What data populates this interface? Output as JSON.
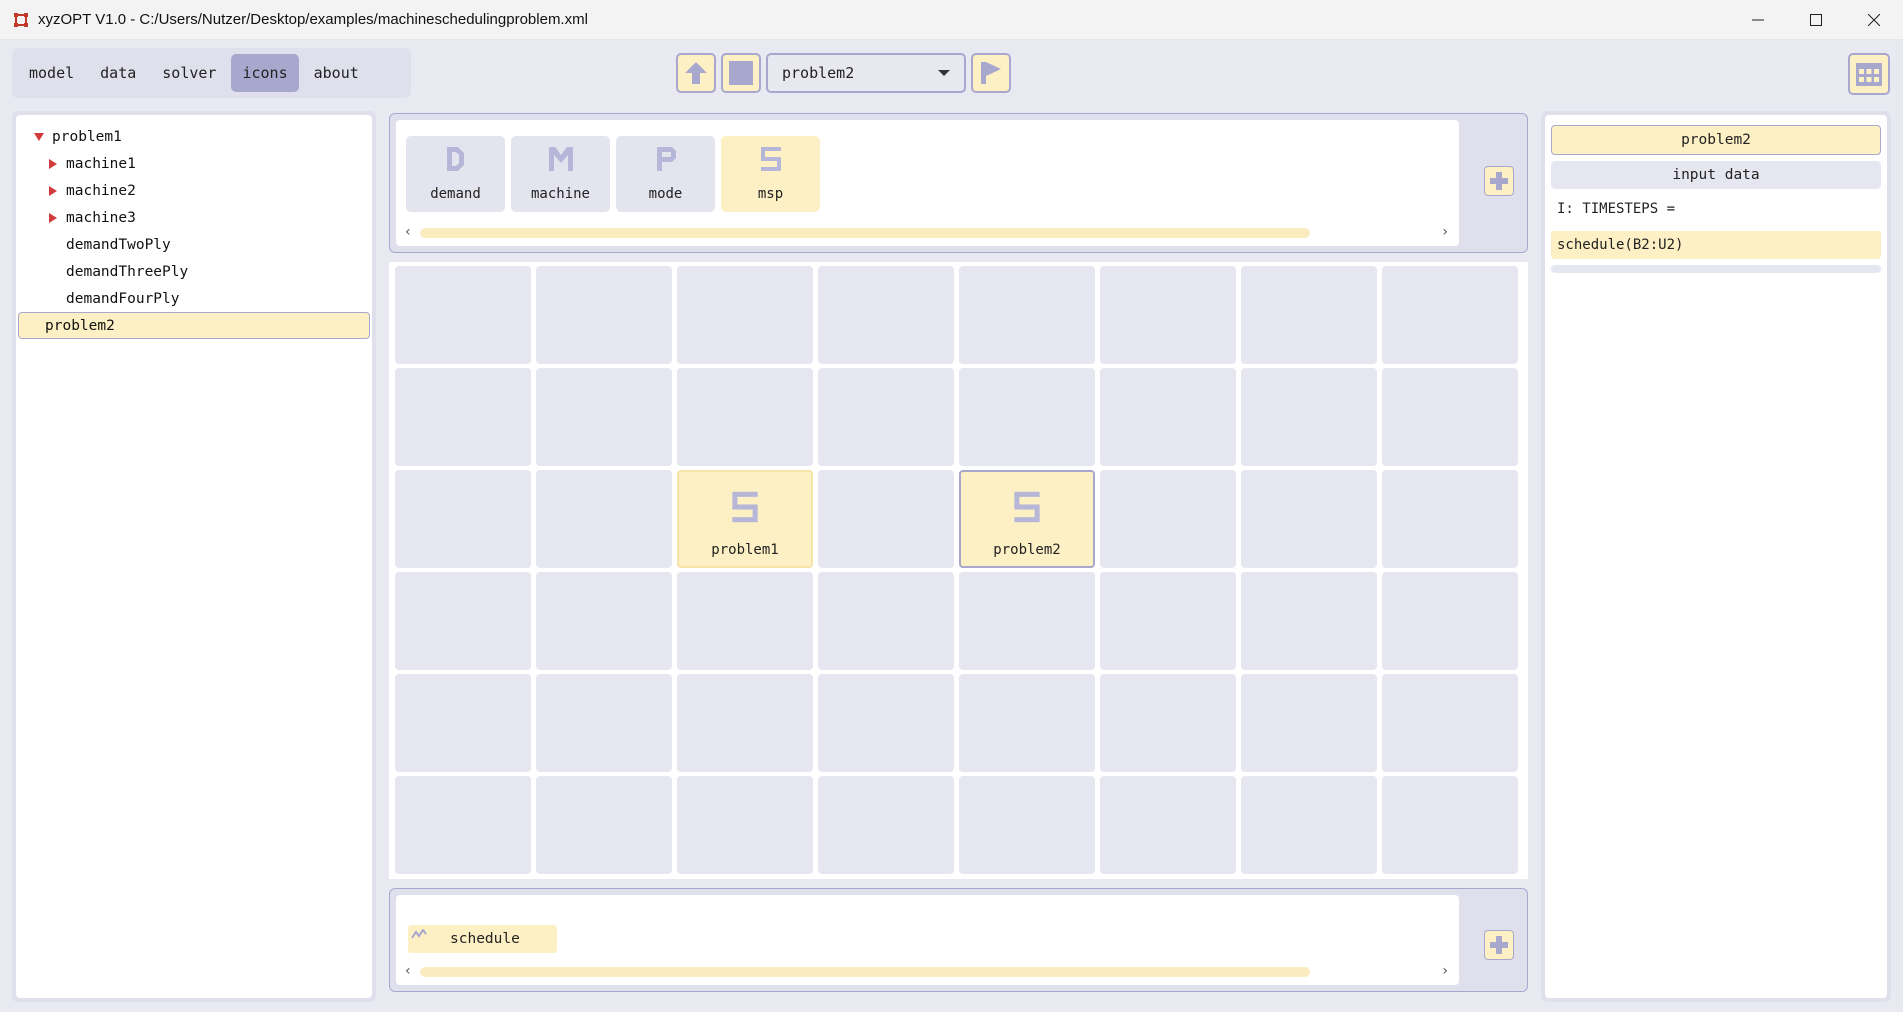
{
  "window": {
    "title": "xyzOPT V1.0 - C:/Users/Nutzer/Desktop/examples/machineschedulingproblem.xml",
    "icon": "app-logo-icon",
    "controls": [
      "minimize-icon",
      "maximize-icon",
      "close-icon"
    ]
  },
  "menu": {
    "items": [
      {
        "label": "model",
        "active": false
      },
      {
        "label": "data",
        "active": false
      },
      {
        "label": "solver",
        "active": false
      },
      {
        "label": "icons",
        "active": true
      },
      {
        "label": "about",
        "active": false
      }
    ]
  },
  "toolbar": {
    "up_icon": "arrow-up-icon",
    "stop_icon": "stop-square-icon",
    "selected_problem": "problem2",
    "run_icon": "flag-run-icon",
    "calendar_icon": "calendar-grid-icon"
  },
  "tree": {
    "items": [
      {
        "label": "problem1",
        "expanded": true,
        "level": 0,
        "selected": false
      },
      {
        "label": "machine1",
        "expanded": false,
        "level": 1,
        "selected": false
      },
      {
        "label": "machine2",
        "expanded": false,
        "level": 1,
        "selected": false
      },
      {
        "label": "machine3",
        "expanded": false,
        "level": 1,
        "selected": false
      },
      {
        "label": "demandTwoPly",
        "level": 1,
        "selected": false
      },
      {
        "label": "demandThreePly",
        "level": 1,
        "selected": false
      },
      {
        "label": "demandFourPly",
        "level": 1,
        "selected": false
      },
      {
        "label": "problem2",
        "level": 0,
        "selected": true
      }
    ]
  },
  "palette": {
    "items": [
      {
        "letter": "D",
        "label": "demand",
        "active": false
      },
      {
        "letter": "M",
        "label": "machine",
        "active": false
      },
      {
        "letter": "P",
        "label": "mode",
        "active": false
      },
      {
        "letter": "S",
        "label": "msp",
        "active": true
      }
    ]
  },
  "grid": {
    "rows": 6,
    "cols": 8,
    "icons": [
      {
        "letter": "S",
        "label": "problem1",
        "selected": false
      },
      {
        "letter": "S",
        "label": "problem2",
        "selected": true
      }
    ]
  },
  "bottom": {
    "items": [
      {
        "label": "schedule",
        "icon": "zigzag-icon"
      }
    ]
  },
  "right": {
    "title": "problem2",
    "subtitle": "input data",
    "timesteps_label": "I: TIMESTEPS =",
    "item": "schedule(B2:U2)"
  },
  "colors": {
    "accent": "#a8a8cf",
    "highlight": "#fdf0c4",
    "panel": "#e0e0ed",
    "cell": "#e6e6f0"
  }
}
